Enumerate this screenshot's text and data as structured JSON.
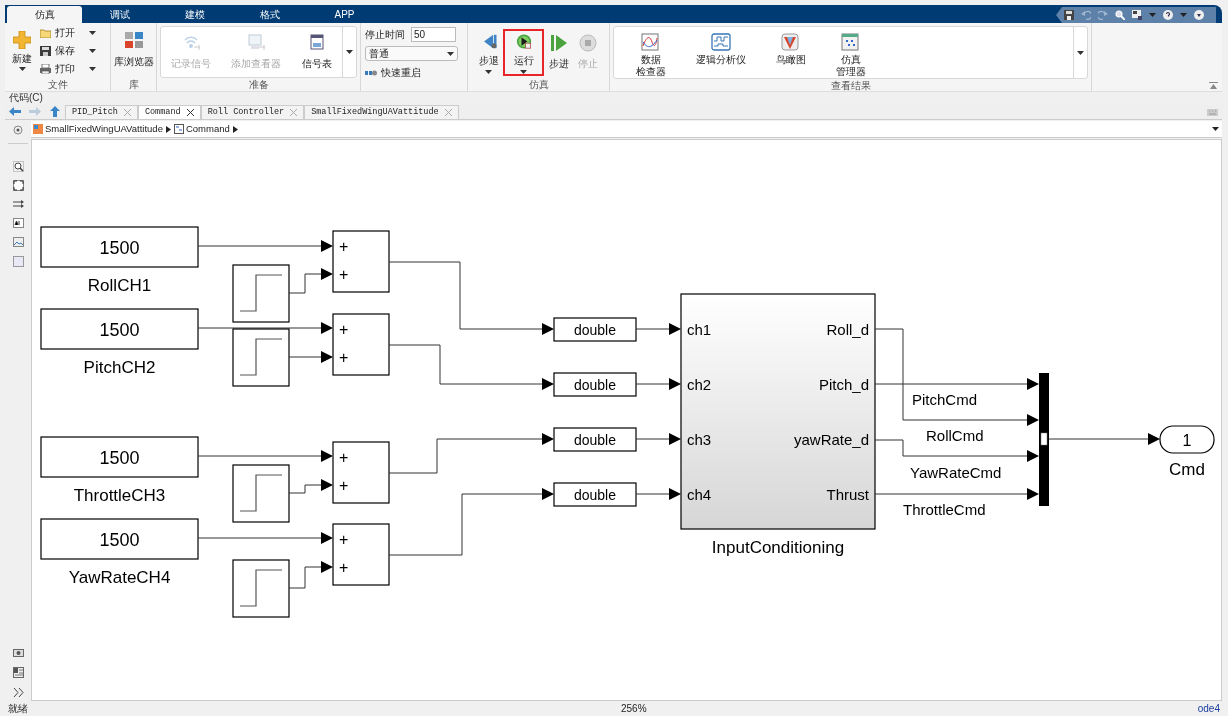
{
  "toolstrip_tabs": [
    {
      "label": "仿真",
      "selected": true
    },
    {
      "label": "调试",
      "selected": false
    },
    {
      "label": "建模",
      "selected": false
    },
    {
      "label": "格式",
      "selected": false
    },
    {
      "label": "APP",
      "selected": false
    }
  ],
  "ribbon": {
    "file": {
      "label": "文件",
      "new": "新建",
      "items": [
        "打开",
        "保存",
        "打印"
      ]
    },
    "library": {
      "label": "库",
      "browser": "库浏览器"
    },
    "prepare": {
      "label": "准备",
      "items": [
        {
          "label": "记录信号",
          "disabled": true
        },
        {
          "label": "添加查看器",
          "disabled": true
        },
        {
          "label": "信号表",
          "disabled": false
        }
      ]
    },
    "stop_time": {
      "label": "停止时间",
      "value": "50"
    },
    "mode": {
      "value": "普通"
    },
    "fast_restart": "快速重启",
    "simulate": {
      "label": "仿真",
      "buttons": [
        {
          "kind": "step_back",
          "label": "步退",
          "disabled": false,
          "highlighted": false
        },
        {
          "kind": "run",
          "label": "运行",
          "disabled": false,
          "highlighted": true
        },
        {
          "kind": "step_forward",
          "label": "步进",
          "disabled": false,
          "highlighted": false
        },
        {
          "kind": "stop",
          "label": "停止",
          "disabled": true,
          "highlighted": false
        }
      ]
    },
    "review": {
      "label": "查看结果",
      "items": [
        {
          "kind": "inspector",
          "lines": [
            "数据",
            "检查器"
          ]
        },
        {
          "kind": "logic",
          "lines": [
            "逻辑分析仪"
          ]
        },
        {
          "kind": "birdseye",
          "lines": [
            "鸟瞰图"
          ]
        },
        {
          "kind": "manager",
          "lines": [
            "仿真",
            "管理器"
          ]
        }
      ]
    }
  },
  "code_menu": "代码(C)",
  "doc_tabs": [
    {
      "label": "PID_Pitch",
      "selected": false
    },
    {
      "label": "Command",
      "selected": true
    },
    {
      "label": "Roll Controller",
      "selected": false
    },
    {
      "label": "SmallFixedWingUAVattitude",
      "selected": false
    }
  ],
  "breadcrumb": [
    "SmallFixedWingUAVattitude",
    "Command"
  ],
  "diagram": {
    "constants": [
      {
        "value": "1500",
        "name": "RollCH1"
      },
      {
        "value": "1500",
        "name": "PitchCH2"
      },
      {
        "value": "1500",
        "name": "ThrottleCH3"
      },
      {
        "value": "1500",
        "name": "YawRateCH4"
      }
    ],
    "sums": [
      [
        "+",
        "+"
      ],
      [
        "+",
        "+"
      ],
      [
        "+",
        "+"
      ],
      [
        "+",
        "+"
      ]
    ],
    "converts": [
      "double",
      "double",
      "double",
      "double"
    ],
    "subsystem": {
      "name": "InputConditioning",
      "inputs": [
        "ch1",
        "ch2",
        "ch3",
        "ch4"
      ],
      "outputs": [
        "Roll_d",
        "Pitch_d",
        "yawRate_d",
        "Thrust"
      ]
    },
    "signal_labels": [
      "PitchCmd",
      "RollCmd",
      "YawRateCmd",
      "ThrottleCmd"
    ],
    "outport": {
      "number": "1",
      "name": "Cmd"
    }
  },
  "status_bar": {
    "state": "就绪",
    "zoom": "256%",
    "solver": "ode4"
  }
}
